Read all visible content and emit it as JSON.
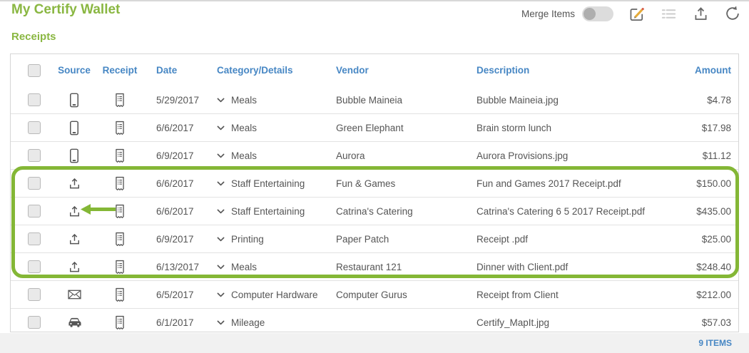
{
  "header": {
    "title": "My Certify Wallet",
    "merge_items_label": "Merge Items",
    "merge_toggle_state": "off",
    "tool_icons": [
      "edit-icon",
      "list-icon",
      "upload-icon",
      "refresh-icon"
    ]
  },
  "section": {
    "title": "Receipts"
  },
  "table": {
    "headers": {
      "source": "Source",
      "receipt": "Receipt",
      "date": "Date",
      "category": "Category/Details",
      "vendor": "Vendor",
      "description": "Description",
      "amount": "Amount"
    },
    "rows": [
      {
        "source_type": "mobile",
        "date": "5/29/2017",
        "category": "Meals",
        "vendor": "Bubble Maineia",
        "description": "Bubble Maineia.jpg",
        "amount": "$4.78",
        "highlighted": false
      },
      {
        "source_type": "mobile",
        "date": "6/6/2017",
        "category": "Meals",
        "vendor": "Green Elephant",
        "description": "Brain storm lunch",
        "amount": "$17.98",
        "highlighted": false
      },
      {
        "source_type": "mobile",
        "date": "6/9/2017",
        "category": "Meals",
        "vendor": "Aurora",
        "description": "Aurora Provisions.jpg",
        "amount": "$11.12",
        "highlighted": false
      },
      {
        "source_type": "upload",
        "date": "6/6/2017",
        "category": "Staff Entertaining",
        "vendor": "Fun & Games",
        "description": "Fun and Games 2017 Receipt.pdf",
        "amount": "$150.00",
        "highlighted": true
      },
      {
        "source_type": "upload",
        "date": "6/6/2017",
        "category": "Staff Entertaining",
        "vendor": "Catrina's Catering",
        "description": "Catrina's Catering 6 5 2017 Receipt.pdf",
        "amount": "$435.00",
        "highlighted": true,
        "annotation": "green-arrow-pointing-to-upload-source"
      },
      {
        "source_type": "upload",
        "date": "6/9/2017",
        "category": "Printing",
        "vendor": "Paper Patch",
        "description": "Receipt .pdf",
        "amount": "$25.00",
        "highlighted": true
      },
      {
        "source_type": "upload",
        "date": "6/13/2017",
        "category": "Meals",
        "vendor": "Restaurant 121",
        "description": "Dinner with Client.pdf",
        "amount": "$248.40",
        "highlighted": true
      },
      {
        "source_type": "email",
        "date": "6/5/2017",
        "category": "Computer Hardware",
        "vendor": "Computer Gurus",
        "description": "Receipt from Client",
        "amount": "$212.00",
        "highlighted": false
      },
      {
        "source_type": "mileage",
        "date": "6/1/2017",
        "category": "Mileage",
        "vendor": "",
        "description": "Certify_MapIt.jpg",
        "amount": "$57.03",
        "highlighted": false
      }
    ]
  },
  "footer": {
    "items_count": "9 ITEMS"
  },
  "colors": {
    "brand_green": "#8ab742",
    "highlight_green": "#84b736",
    "link_blue": "#4787c4",
    "text_gray": "#555555",
    "pencil_yellow": "#e5ab3a"
  }
}
